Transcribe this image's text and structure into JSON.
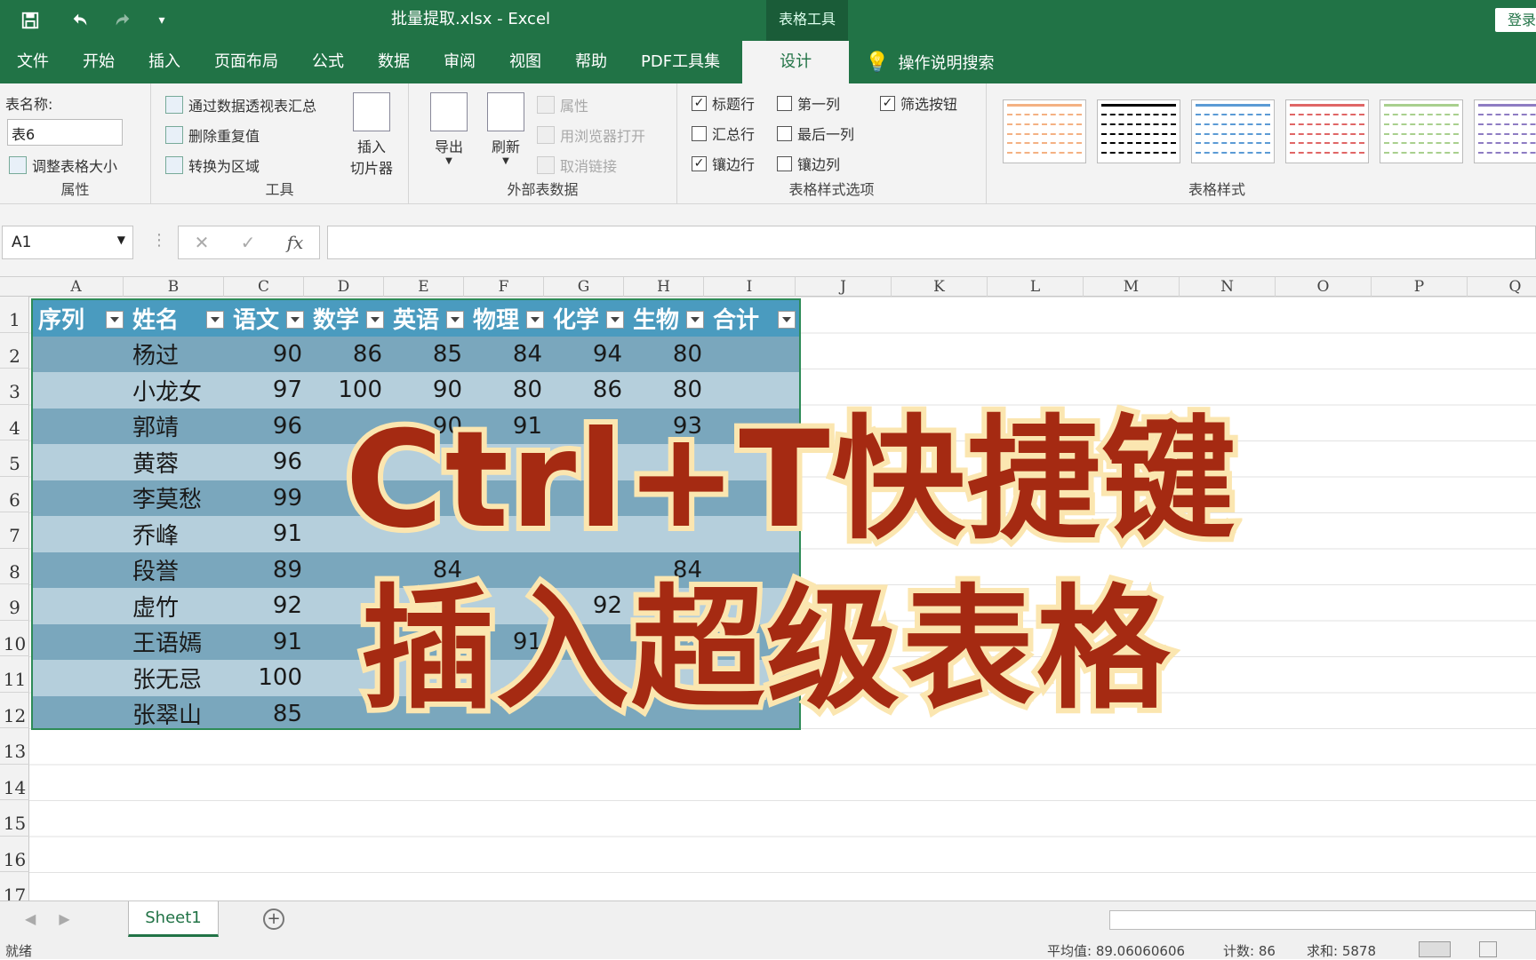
{
  "titlebar": {
    "title": "批量提取.xlsx  -  Excel",
    "context_tab": "表格工具",
    "login": "登录"
  },
  "tabs": [
    "文件",
    "开始",
    "插入",
    "页面布局",
    "公式",
    "数据",
    "审阅",
    "视图",
    "帮助",
    "PDF工具集"
  ],
  "active_tab": "设计",
  "tellme": "操作说明搜索",
  "ribbon": {
    "props": {
      "label": "表名称:",
      "table_name": "表6",
      "resize": "调整表格大小",
      "group": "属性"
    },
    "tools": {
      "pivot": "通过数据透视表汇总",
      "dedupe": "删除重复值",
      "convert": "转换为区域",
      "slicer_1": "插入",
      "slicer_2": "切片器",
      "group": "工具"
    },
    "external": {
      "export": "导出",
      "refresh": "刷新",
      "properties": "属性",
      "browser": "用浏览器打开",
      "unlink": "取消链接",
      "group": "外部表数据"
    },
    "options": {
      "header_row": "标题行",
      "total_row": "汇总行",
      "banded_rows": "镶边行",
      "first_col": "第一列",
      "last_col": "最后一列",
      "banded_cols": "镶边列",
      "filter_btn": "筛选按钮",
      "group": "表格样式选项"
    },
    "styles": {
      "group": "表格样式",
      "colors": [
        "#f4b183",
        "#000000",
        "#5b9bd5",
        "#e06666",
        "#a9d08e",
        "#8e7cc3"
      ]
    }
  },
  "formula_bar": {
    "cell_ref": "A1",
    "fx": "fx",
    "cancel": "✕",
    "enter": "✓"
  },
  "columns": [
    "A",
    "B",
    "C",
    "D",
    "E",
    "F",
    "G",
    "H",
    "I",
    "J",
    "K",
    "L",
    "M",
    "N",
    "O",
    "P",
    "Q"
  ],
  "rows": [
    "1",
    "2",
    "3",
    "4",
    "5",
    "6",
    "7",
    "8",
    "9",
    "10",
    "11",
    "12",
    "13",
    "14",
    "15",
    "16",
    "17"
  ],
  "table": {
    "headers": [
      "序列",
      "姓名",
      "语文",
      "数学",
      "英语",
      "物理",
      "化学",
      "生物",
      "合计"
    ],
    "rows": [
      [
        "",
        "杨过",
        "90",
        "86",
        "85",
        "84",
        "94",
        "80",
        ""
      ],
      [
        "",
        "小龙女",
        "97",
        "100",
        "90",
        "80",
        "86",
        "80",
        ""
      ],
      [
        "",
        "郭靖",
        "96",
        "",
        "90",
        "91",
        "",
        "93",
        ""
      ],
      [
        "",
        "黄蓉",
        "96",
        "94",
        "",
        "",
        "",
        "",
        ""
      ],
      [
        "",
        "李莫愁",
        "99",
        "90",
        "",
        "",
        "",
        "",
        ""
      ],
      [
        "",
        "乔峰",
        "91",
        "",
        "",
        "",
        "",
        "",
        ""
      ],
      [
        "",
        "段誉",
        "89",
        "",
        "84",
        "",
        "",
        "84",
        ""
      ],
      [
        "",
        "虚竹",
        "92",
        "",
        "",
        "",
        "92",
        "",
        ""
      ],
      [
        "",
        "王语嫣",
        "91",
        "",
        "",
        "91",
        "",
        "",
        ""
      ],
      [
        "",
        "张无忌",
        "100",
        "",
        "",
        "",
        "",
        "",
        ""
      ],
      [
        "",
        "张翠山",
        "85",
        "",
        "",
        "",
        "",
        "",
        ""
      ]
    ]
  },
  "overlay": {
    "line1": "Ctrl+T快捷键",
    "line2": "插入超级表格"
  },
  "sheet_tab": "Sheet1",
  "status": {
    "ready": "就绪",
    "avg": "平均值: 89.06060606",
    "count": "计数: 86",
    "sum": "求和: 5878"
  }
}
